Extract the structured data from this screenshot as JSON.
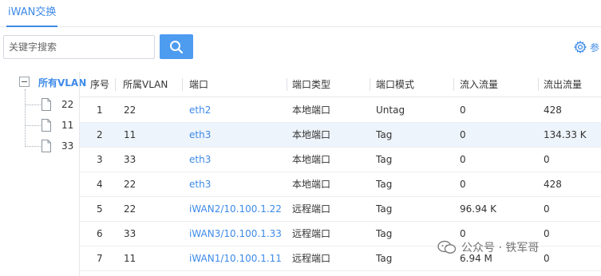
{
  "tab": {
    "label": "iWAN交换"
  },
  "search": {
    "placeholder": "关键字搜索"
  },
  "toolbar": {
    "settings_label": "参"
  },
  "tree": {
    "root_label": "所有VLAN",
    "nodes": [
      "22",
      "11",
      "33"
    ]
  },
  "table": {
    "columns": [
      "序号",
      "所属VLAN",
      "端口",
      "端口类型",
      "端口模式",
      "流入流量",
      "流出流量"
    ],
    "rows": [
      {
        "index": "1",
        "vlan": "22",
        "port": "eth2",
        "type": "本地端口",
        "mode": "Untag",
        "in": "0",
        "out": "428"
      },
      {
        "index": "2",
        "vlan": "11",
        "port": "eth3",
        "type": "本地端口",
        "mode": "Tag",
        "in": "0",
        "out": "134.33 K"
      },
      {
        "index": "3",
        "vlan": "33",
        "port": "eth3",
        "type": "本地端口",
        "mode": "Tag",
        "in": "0",
        "out": "0"
      },
      {
        "index": "4",
        "vlan": "22",
        "port": "eth3",
        "type": "本地端口",
        "mode": "Tag",
        "in": "0",
        "out": "428"
      },
      {
        "index": "5",
        "vlan": "22",
        "port": "iWAN2/10.100.1.22",
        "type": "远程端口",
        "mode": "Tag",
        "in": "96.94 K",
        "out": "0"
      },
      {
        "index": "6",
        "vlan": "33",
        "port": "iWAN3/10.100.1.33",
        "type": "远程端口",
        "mode": "Tag",
        "in": "0",
        "out": "0"
      },
      {
        "index": "7",
        "vlan": "11",
        "port": "iWAN1/10.100.1.11",
        "type": "远程端口",
        "mode": "Tag",
        "in": "6.94 M",
        "out": "0"
      }
    ]
  },
  "watermark": {
    "text": "公众号 · 铁军哥"
  },
  "colors": {
    "accent": "#3d8ae8",
    "button": "#4d9cf0",
    "selected_row": "#eef4fb"
  }
}
